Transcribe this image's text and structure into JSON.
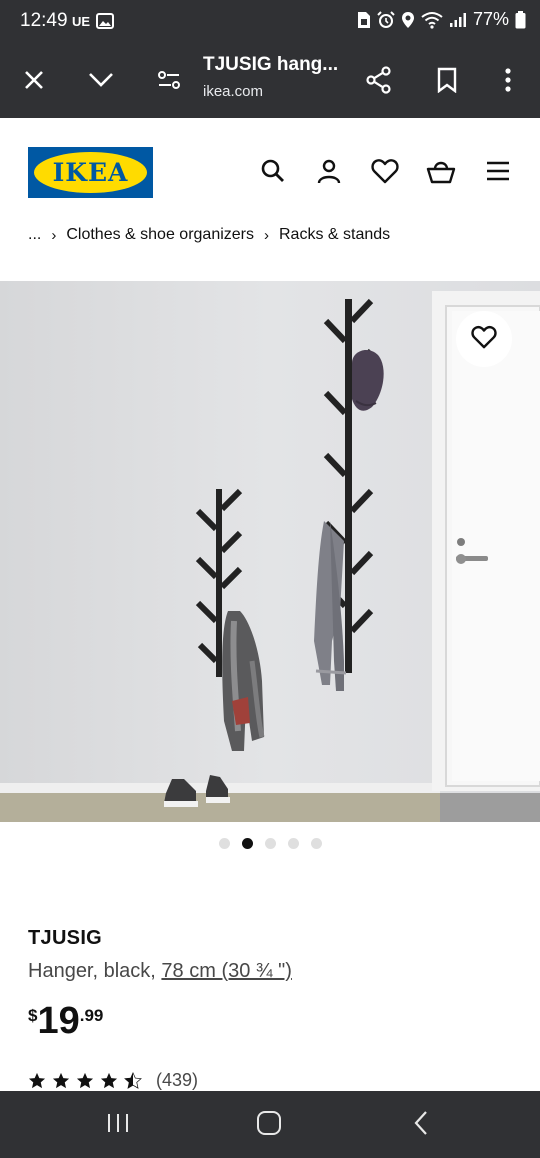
{
  "status_bar": {
    "time": "12:49",
    "carrier": "UE",
    "battery": "77%",
    "icons": [
      "gallery-icon",
      "sim-icon",
      "alarm-icon",
      "location-icon",
      "wifi-icon",
      "signal-icon",
      "battery-icon"
    ]
  },
  "browser": {
    "page_title": "TJUSIG hang...",
    "url": "ikea.com",
    "icons": [
      "close-icon",
      "chevron-down-icon",
      "page-settings-icon",
      "share-icon",
      "bookmark-icon",
      "more-vertical-icon"
    ]
  },
  "site_header": {
    "logo_text": "IKEA",
    "brand_colors": {
      "blue": "#0058a3",
      "yellow": "#ffdb00"
    },
    "icons": [
      "search-icon",
      "profile-icon",
      "heart-icon",
      "cart-icon",
      "menu-icon"
    ]
  },
  "breadcrumb": {
    "items": [
      "...",
      "Clothes & shoe organizers",
      "Racks & stands"
    ]
  },
  "gallery": {
    "image_count": 5,
    "active_index": 1,
    "favorite_icon": "heart-icon"
  },
  "product": {
    "name": "TJUSIG",
    "description": "Hanger, black, ",
    "size": "78 cm (30 ¾ \")",
    "price_currency": "$",
    "price_integer": "19",
    "price_decimal": ".99",
    "rating": 4.5,
    "rating_max": 5,
    "review_count": "(439)"
  },
  "nav_bar": {
    "icons": [
      "recent-apps-icon",
      "home-icon",
      "back-icon"
    ]
  }
}
